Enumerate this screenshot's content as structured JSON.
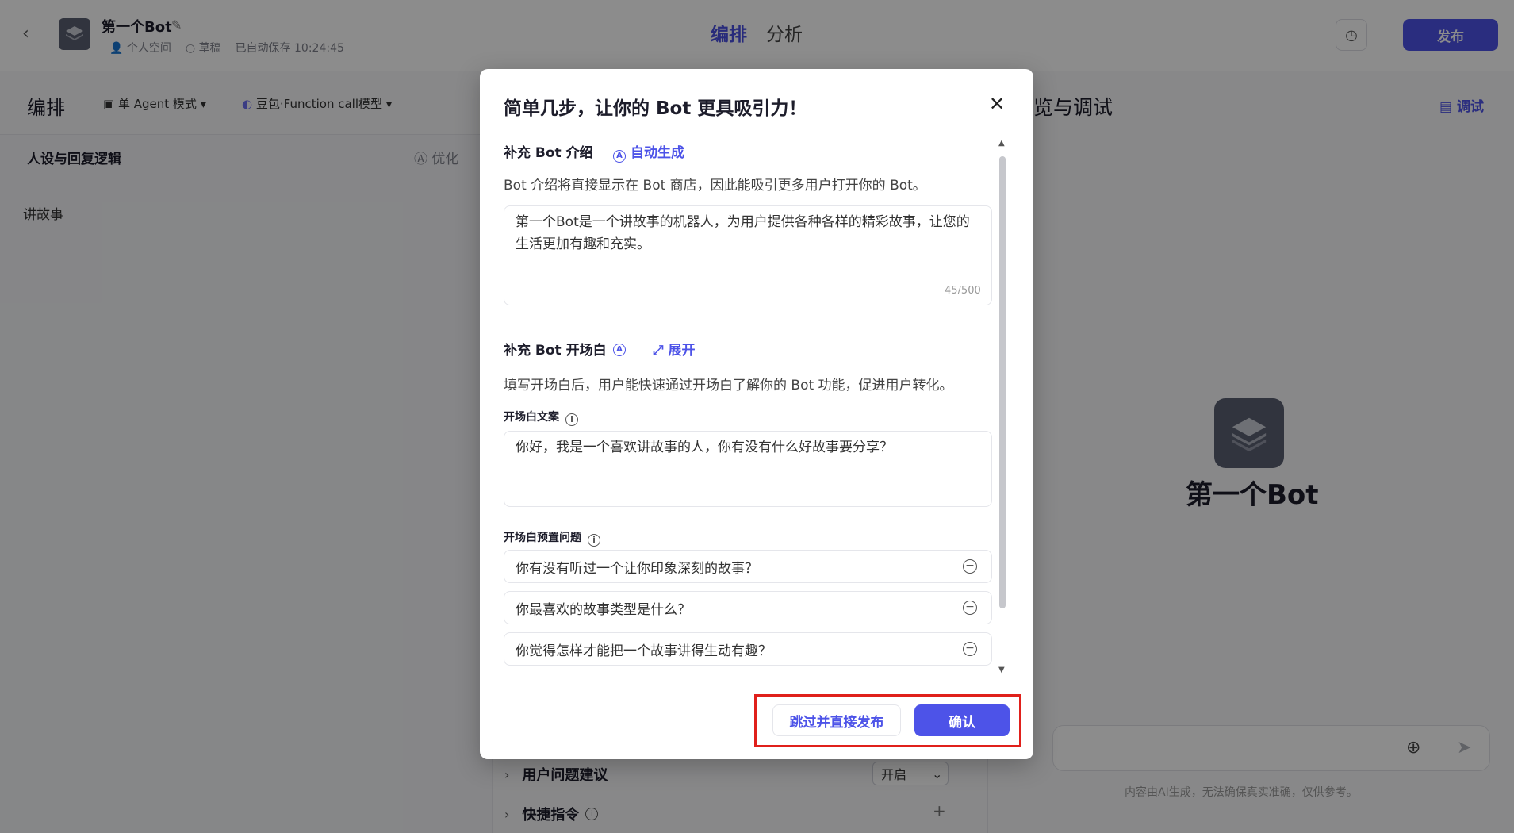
{
  "header": {
    "bot_title": "第一个Bot",
    "space": "个人空间",
    "status": "草稿",
    "autosave": "已自动保存 10:24:45",
    "tabs": [
      {
        "label": "编排"
      },
      {
        "label": "分析"
      }
    ],
    "publish_label": "发布"
  },
  "editor": {
    "title": "编排",
    "mode": "单 Agent 模式",
    "model": "豆包·Function call模型",
    "persona_title": "人设与回复逻辑",
    "optimize_label": "优化",
    "persona_text": "讲故事",
    "suggest_label": "用户问题建议",
    "suggest_value": "开启",
    "shortcut_label": "快捷指令"
  },
  "preview": {
    "title": "预览与调试",
    "debug_label": "调试",
    "bot_name": "第一个Bot",
    "disclaimer": "内容由AI生成，无法确保真实准确，仅供参考。"
  },
  "modal": {
    "title": "简单几步，让你的 Bot 更具吸引力！",
    "intro_section": {
      "title": "补充 Bot 介绍",
      "auto_label": "自动生成",
      "description": "Bot 介绍将直接显示在 Bot 商店，因此能吸引更多用户打开你的 Bot。",
      "value": "第一个Bot是一个讲故事的机器人，为用户提供各种各样的精彩故事，让您的生活更加有趣和充实。",
      "counter": "45/500"
    },
    "opening_section": {
      "title": "补充 Bot 开场白",
      "expand_label": "展开",
      "description": "填写开场白后，用户能快速通过开场白了解你的 Bot 功能，促进用户转化。",
      "text_label": "开场白文案",
      "text_value": "你好，我是一个喜欢讲故事的人，你有没有什么好故事要分享？",
      "questions_label": "开场白预置问题",
      "questions": [
        {
          "text": "你有没有听过一个让你印象深刻的故事？"
        },
        {
          "text": "你最喜欢的故事类型是什么？"
        },
        {
          "text": "你觉得怎样才能把一个故事讲得生动有趣？"
        }
      ]
    },
    "skip_label": "跳过并直接发布",
    "confirm_label": "确认"
  }
}
